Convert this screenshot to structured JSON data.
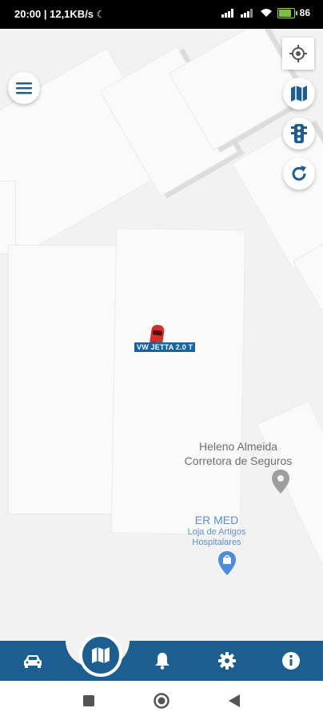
{
  "status_bar": {
    "time_speed": "20:00 | 12,1KB/s",
    "moon_icon": "moon-icon",
    "signal": "signal-icon",
    "wifi": "wifi-icon",
    "battery_level": 86,
    "battery_text": "86"
  },
  "map": {
    "vehicle": {
      "label": "VW JETTA 2.0 T",
      "color": "#d32f2f"
    },
    "pois": [
      {
        "name_line1": "Heleno Almeida",
        "name_line2": "Corretora de Seguros"
      },
      {
        "name": "ER MED",
        "sub_line1": "Loja de Artigos",
        "sub_line2": "Hospitalares"
      }
    ]
  },
  "controls": {
    "menu_icon": "menu-icon",
    "locate_icon": "crosshair-icon",
    "map_type_icon": "map-icon",
    "traffic_icon": "traffic-light-icon",
    "refresh_icon": "refresh-icon"
  },
  "bottom_nav": {
    "accent": "#1b5e8f",
    "items": [
      "car-icon",
      "map-icon",
      "bell-icon",
      "gear-icon",
      "info-icon"
    ],
    "active": "map-icon"
  },
  "system_nav": [
    "recents-square-icon",
    "home-circle-icon",
    "back-triangle-icon"
  ]
}
